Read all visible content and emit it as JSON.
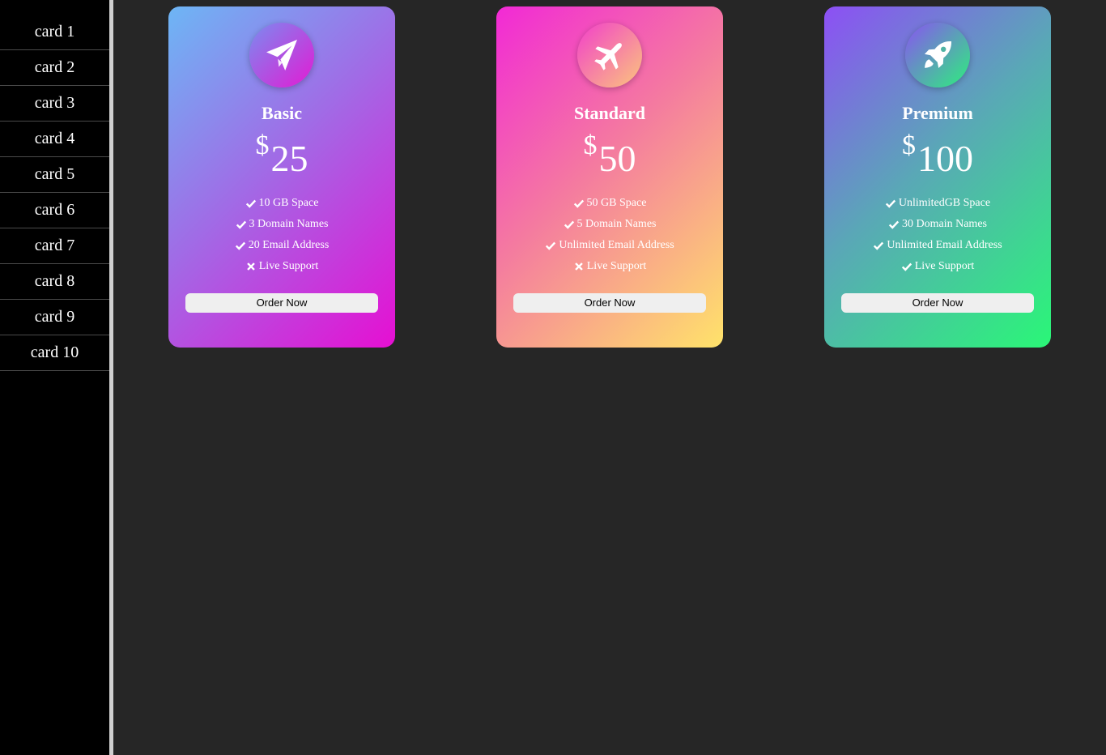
{
  "sidebar": {
    "items": [
      {
        "label": "card 1"
      },
      {
        "label": "card 2"
      },
      {
        "label": "card 3"
      },
      {
        "label": "card 4"
      },
      {
        "label": "card 5"
      },
      {
        "label": "card 6"
      },
      {
        "label": "card 7"
      },
      {
        "label": "card 8"
      },
      {
        "label": "card 9"
      },
      {
        "label": "card 10"
      }
    ]
  },
  "cards": [
    {
      "name": "Basic",
      "icon": "paper-plane-icon",
      "currency": "$",
      "price": "25",
      "features": [
        {
          "text": "10 GB Space",
          "included": true
        },
        {
          "text": "3 Domain Names",
          "included": true
        },
        {
          "text": "20 Email Address",
          "included": true
        },
        {
          "text": "Live Support",
          "included": false
        }
      ],
      "button": "Order Now"
    },
    {
      "name": "Standard",
      "icon": "airplane-icon",
      "currency": "$",
      "price": "50",
      "features": [
        {
          "text": "50 GB Space",
          "included": true
        },
        {
          "text": "5 Domain Names",
          "included": true
        },
        {
          "text": "Unlimited Email Address",
          "included": true
        },
        {
          "text": "Live Support",
          "included": false
        }
      ],
      "button": "Order Now"
    },
    {
      "name": "Premium",
      "icon": "rocket-icon",
      "currency": "$",
      "price": "100",
      "features": [
        {
          "text": "UnlimitedGB Space",
          "included": true
        },
        {
          "text": "30 Domain Names",
          "included": true
        },
        {
          "text": "Unlimited Email Address",
          "included": true
        },
        {
          "text": "Live Support",
          "included": true
        }
      ],
      "button": "Order Now"
    }
  ],
  "colors": {
    "page_background": "#262626",
    "sidebar_background": "#000000",
    "button_background": "#efefef"
  }
}
